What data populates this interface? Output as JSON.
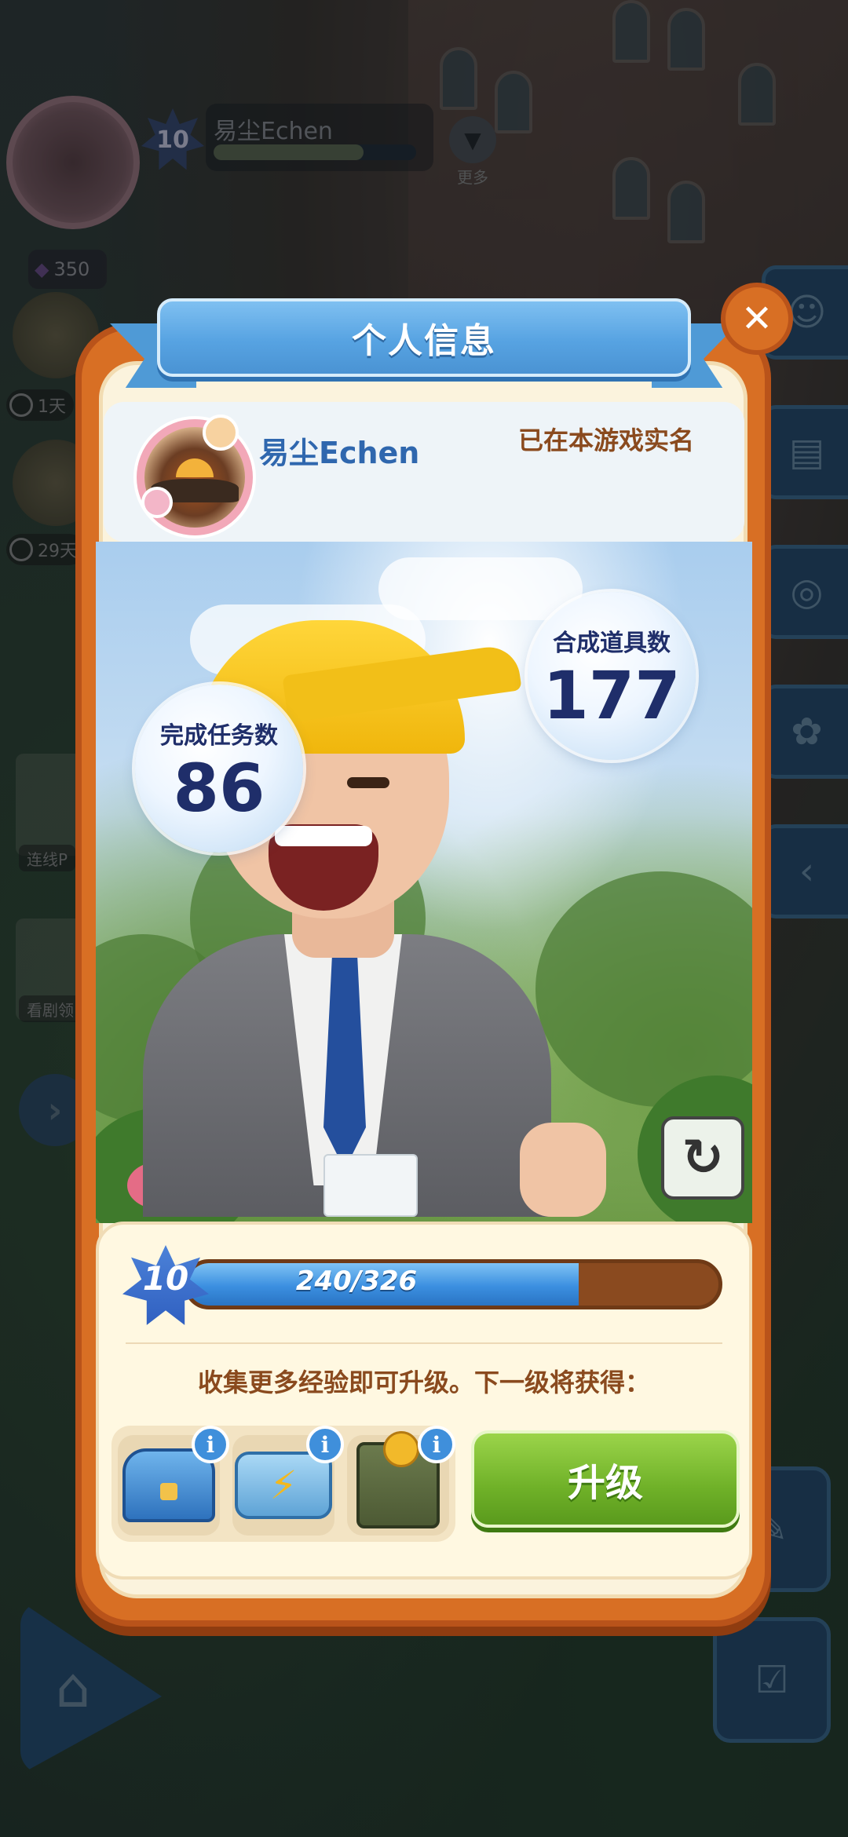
{
  "hud": {
    "level": "10",
    "player_name": "易尘Echen",
    "xp_progress": 0.74,
    "more_label": "更多",
    "gems": "350",
    "event_timer_1": "1天",
    "event_timer_2": "29天",
    "left_card_1": "连线P",
    "left_card_2": "看剧领"
  },
  "modal": {
    "title": "个人信息",
    "close_icon": "close-icon",
    "profile": {
      "name": "易尘Echen",
      "verified_text": "已在本游戏实名"
    },
    "stats": {
      "tasks_label": "完成任务数",
      "tasks_value": "86",
      "items_label": "合成道具数",
      "items_value": "177"
    },
    "refresh_icon": "refresh-icon",
    "level": {
      "current": "10",
      "xp_text": "240/326",
      "xp_current": 240,
      "xp_max": 326
    },
    "hint": "收集更多经验即可升级。下一级将获得：",
    "rewards": [
      {
        "icon": "blue-chest-icon",
        "info": "i"
      },
      {
        "icon": "energy-case-icon",
        "info": "i"
      },
      {
        "icon": "coin-box-icon",
        "info": "i"
      }
    ],
    "upgrade_label": "升级"
  },
  "colors": {
    "modal_orange": "#d86f24",
    "ribbon_blue": "#57a3e2",
    "upgrade_green": "#6fb128",
    "xp_blue": "#3b8fe0",
    "text_brown": "#8a4a1e"
  }
}
